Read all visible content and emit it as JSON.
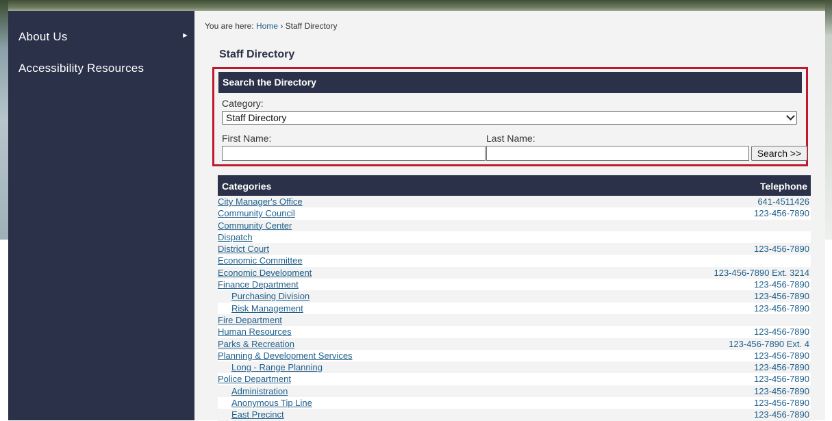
{
  "sidebar": {
    "items": [
      {
        "label": "About Us",
        "has_submenu": true
      },
      {
        "label": "Accessibility Resources",
        "has_submenu": false
      }
    ]
  },
  "breadcrumb": {
    "prefix": "You are here:",
    "home": "Home",
    "separator": "›",
    "current": "Staff Directory"
  },
  "page_title": "Staff Directory",
  "search": {
    "header": "Search the Directory",
    "category_label": "Category:",
    "category_value": "Staff Directory",
    "first_name_label": "First Name:",
    "first_name_value": "",
    "last_name_label": "Last Name:",
    "last_name_value": "",
    "button_label": "Search >>"
  },
  "table": {
    "col_categories": "Categories",
    "col_telephone": "Telephone",
    "rows": [
      {
        "name": "City Manager's Office",
        "tel": "641-4511426",
        "level": 0
      },
      {
        "name": "Community Council",
        "tel": "123-456-7890",
        "level": 0
      },
      {
        "name": "Community Center",
        "tel": "",
        "level": 0
      },
      {
        "name": "Dispatch",
        "tel": "",
        "level": 0
      },
      {
        "name": "District Court",
        "tel": "123-456-7890",
        "level": 0
      },
      {
        "name": "Economic Committee",
        "tel": "",
        "level": 0
      },
      {
        "name": "Economic Development",
        "tel": "123-456-7890 Ext. 3214",
        "level": 0
      },
      {
        "name": "Finance Department",
        "tel": "123-456-7890",
        "level": 0
      },
      {
        "name": "Purchasing Division",
        "tel": "123-456-7890",
        "level": 1
      },
      {
        "name": "Risk Management",
        "tel": "123-456-7890",
        "level": 1
      },
      {
        "name": "Fire Department",
        "tel": "",
        "level": 0
      },
      {
        "name": "Human Resources",
        "tel": "123-456-7890",
        "level": 0
      },
      {
        "name": "Parks & Recreation",
        "tel": "123-456-7890 Ext. 4",
        "level": 0
      },
      {
        "name": "Planning & Development Services",
        "tel": "123-456-7890",
        "level": 0
      },
      {
        "name": "Long - Range Planning",
        "tel": "123-456-7890",
        "level": 1
      },
      {
        "name": "Police Department",
        "tel": "123-456-7890",
        "level": 0
      },
      {
        "name": "Administration",
        "tel": "123-456-7890",
        "level": 1
      },
      {
        "name": "Anonymous Tip Line",
        "tel": "123-456-7890",
        "level": 1
      },
      {
        "name": "East Precinct",
        "tel": "123-456-7890",
        "level": 1
      }
    ]
  },
  "colors": {
    "navy": "#2b3149",
    "link": "#1f5f8b",
    "highlight_border": "#c0182d"
  }
}
